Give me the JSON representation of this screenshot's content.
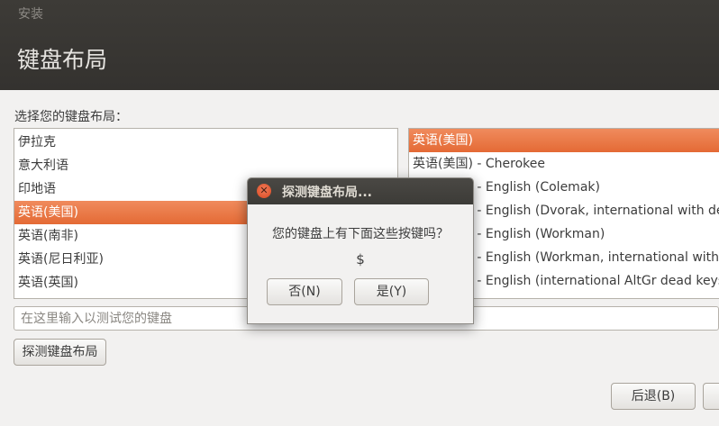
{
  "window": {
    "title": "安装"
  },
  "page": {
    "title": "键盘布局"
  },
  "prompt": "选择您的键盘布局：",
  "layouts": [
    "伊拉克",
    "意大利语",
    "印地语",
    "英语(美国)",
    "英语(南非)",
    "英语(尼日利亚)",
    "英语(英国)"
  ],
  "selected_layout": "英语(美国)",
  "variants": [
    "英语(美国)",
    "英语(美国) - Cherokee",
    "英语(美国) - English (Colemak)",
    "英语(美国) - English (Dvorak, international with dead keys)",
    "英语(美国) - English (Workman)",
    "英语(美国) - English (Workman, international with dead keys)",
    "英语(美国) - English (international AltGr dead keys)"
  ],
  "selected_variant": "英语(美国)",
  "test_input": {
    "placeholder": "在这里输入以测试您的键盘",
    "value": ""
  },
  "buttons": {
    "detect": "探测键盘布局",
    "back": "后退(B)",
    "next": ""
  },
  "dialog": {
    "title": "探测键盘布局...",
    "message": "您的键盘上有下面这些按键吗？",
    "key": "$",
    "no_label": "否(N)",
    "yes_label": "是(Y)"
  },
  "colors": {
    "accent": "#e8733f",
    "titlebar": "#3c3b37"
  },
  "icons": {
    "dialog_close": "close-icon"
  }
}
